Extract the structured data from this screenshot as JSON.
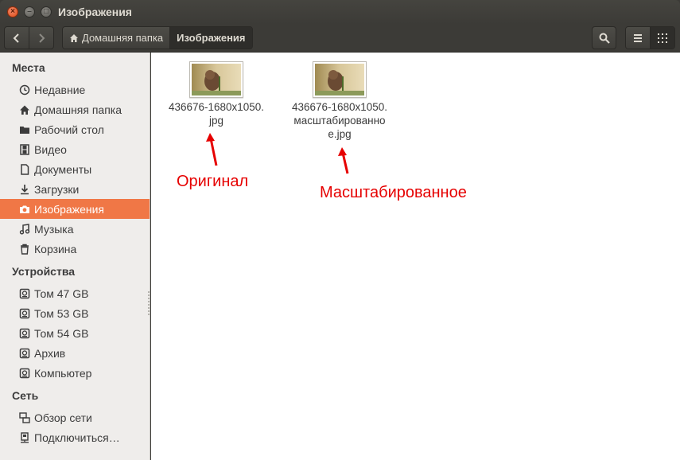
{
  "window": {
    "title": "Изображения"
  },
  "toolbar": {
    "breadcrumbs": [
      {
        "label": "Домашняя папка"
      },
      {
        "label": "Изображения"
      }
    ]
  },
  "sidebar": {
    "places": {
      "header": "Места",
      "items": [
        {
          "label": "Недавние",
          "icon": "clock-icon"
        },
        {
          "label": "Домашняя папка",
          "icon": "home-icon"
        },
        {
          "label": "Рабочий стол",
          "icon": "folder-icon"
        },
        {
          "label": "Видео",
          "icon": "film-icon"
        },
        {
          "label": "Документы",
          "icon": "document-icon"
        },
        {
          "label": "Загрузки",
          "icon": "download-icon"
        },
        {
          "label": "Изображения",
          "icon": "camera-icon",
          "selected": true
        },
        {
          "label": "Музыка",
          "icon": "music-icon"
        },
        {
          "label": "Корзина",
          "icon": "trash-icon"
        }
      ]
    },
    "devices": {
      "header": "Устройства",
      "items": [
        {
          "label": "Том 47 GB",
          "icon": "drive-icon"
        },
        {
          "label": "Том 53 GB",
          "icon": "drive-icon"
        },
        {
          "label": "Том 54 GB",
          "icon": "drive-icon"
        },
        {
          "label": "Архив",
          "icon": "drive-icon"
        },
        {
          "label": "Компьютер",
          "icon": "drive-icon"
        }
      ]
    },
    "network": {
      "header": "Сеть",
      "items": [
        {
          "label": "Обзор сети",
          "icon": "network-icon"
        },
        {
          "label": "Подключиться…",
          "icon": "server-icon"
        }
      ]
    }
  },
  "files": [
    {
      "name": "436676-1680x1050.jpg",
      "name_lines": [
        "436676-1680x1050.",
        "jpg"
      ]
    },
    {
      "name": "436676-1680x1050.масштабированное.jpg",
      "name_lines": [
        "436676-1680x1050.",
        "масштабированно",
        "е.jpg"
      ]
    }
  ],
  "annotations": {
    "original": "Оригинал",
    "scaled": "Масштабированное",
    "color": "#e60000"
  },
  "colors": {
    "accent": "#f07746",
    "titlebar": "#3c3b37",
    "sidebar": "#efedeb"
  }
}
